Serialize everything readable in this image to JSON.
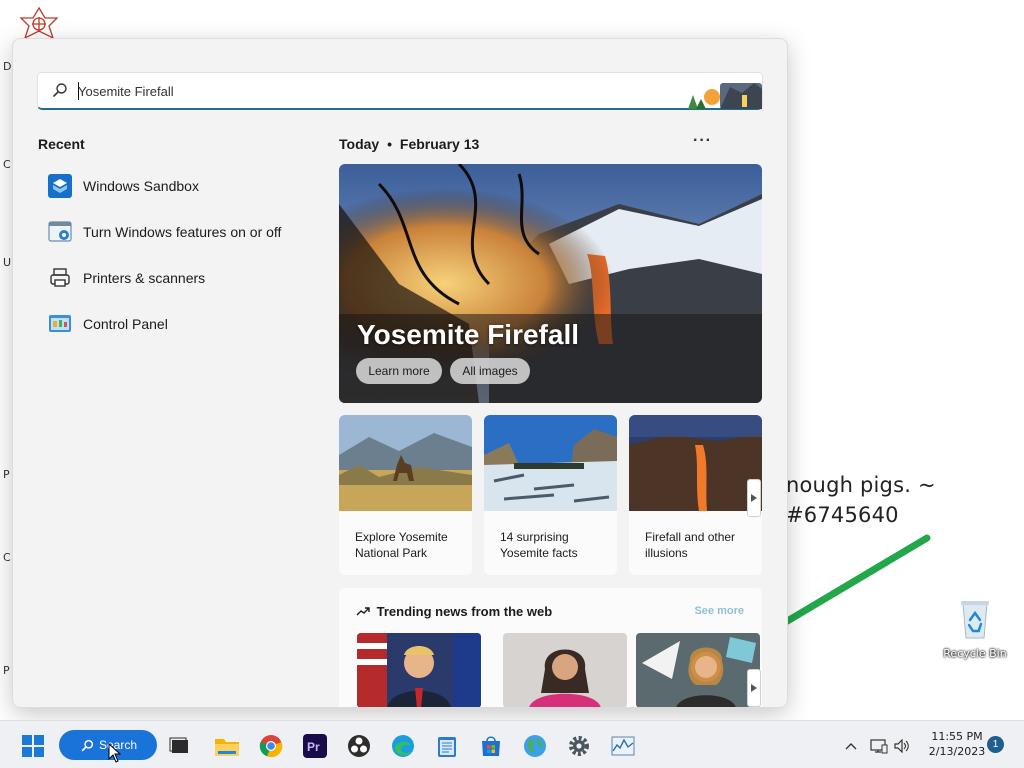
{
  "desktop": {
    "edge_letters": [
      "D",
      "C",
      "U",
      "P",
      "C",
      "P"
    ],
    "wallpaper_text": [
      "nough pigs.  ~",
      "#6745640"
    ],
    "recycle_bin_label": "Recycle Bin"
  },
  "search": {
    "query": "Yosemite Firefall"
  },
  "recent": {
    "heading": "Recent",
    "items": [
      {
        "label": "Windows Sandbox",
        "icon": "windows-sandbox-icon"
      },
      {
        "label": "Turn Windows features on or off",
        "icon": "windows-features-icon"
      },
      {
        "label": "Printers & scanners",
        "icon": "printer-icon"
      },
      {
        "label": "Control Panel",
        "icon": "control-panel-icon"
      }
    ]
  },
  "today": {
    "label": "Today",
    "separator": "•",
    "date": "February 13",
    "more": "···"
  },
  "hero": {
    "title": "Yosemite Firefall",
    "buttons": [
      "Learn more",
      "All images"
    ]
  },
  "cards": [
    {
      "caption": "Explore Yosemite National Park"
    },
    {
      "caption": "14 surprising Yosemite facts"
    },
    {
      "caption": "Firefall and other illusions"
    }
  ],
  "trending": {
    "title": "Trending news from the web",
    "see_more": "See more"
  },
  "taskbar": {
    "search_label": "Search",
    "time": "11:55 PM",
    "date": "2/13/2023",
    "notification_count": "1"
  },
  "colors": {
    "accent": "#1f6d92",
    "taskbar_search": "#1a73d9",
    "panel_bg": "#f3f3f3"
  }
}
